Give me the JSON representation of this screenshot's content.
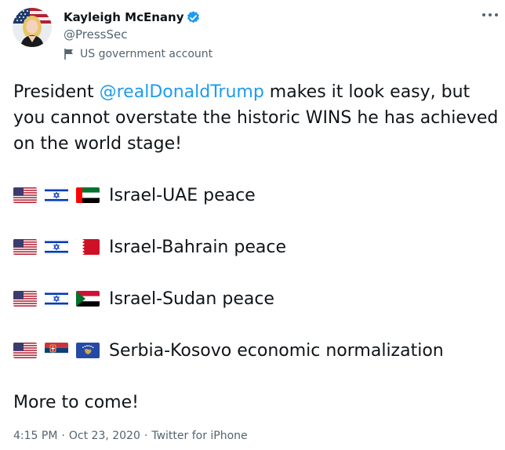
{
  "author": {
    "display_name": "Kayleigh McEnany",
    "handle": "@PressSec",
    "gov_label": "US government account",
    "verified_color": "#1d9bf0",
    "avatar": "avatar-photo"
  },
  "tweet": {
    "text_before": "President ",
    "mention": "@realDonaldTrump",
    "text_after": " makes it look easy, but you cannot overstate the historic WINS he has achieved on the world stage!",
    "rows": [
      {
        "flags": [
          "us-flag-icon",
          "israel-flag-icon",
          "uae-flag-icon"
        ],
        "label": "Israel-UAE peace"
      },
      {
        "flags": [
          "us-flag-icon",
          "israel-flag-icon",
          "bahrain-flag-icon"
        ],
        "label": "Israel-Bahrain peace"
      },
      {
        "flags": [
          "us-flag-icon",
          "israel-flag-icon",
          "sudan-flag-icon"
        ],
        "label": "Israel-Sudan peace"
      },
      {
        "flags": [
          "us-flag-icon",
          "serbia-flag-icon",
          "kosovo-flag-icon"
        ],
        "label": "Serbia-Kosovo economic normalization"
      }
    ],
    "closing": "More to come!"
  },
  "meta": {
    "time": "4:15 PM",
    "date": "Oct 23, 2020",
    "source": "Twitter for iPhone",
    "separator": "·"
  },
  "colors": {
    "text": "#0f1419",
    "secondary": "#536471",
    "link": "#1d9bf0"
  }
}
